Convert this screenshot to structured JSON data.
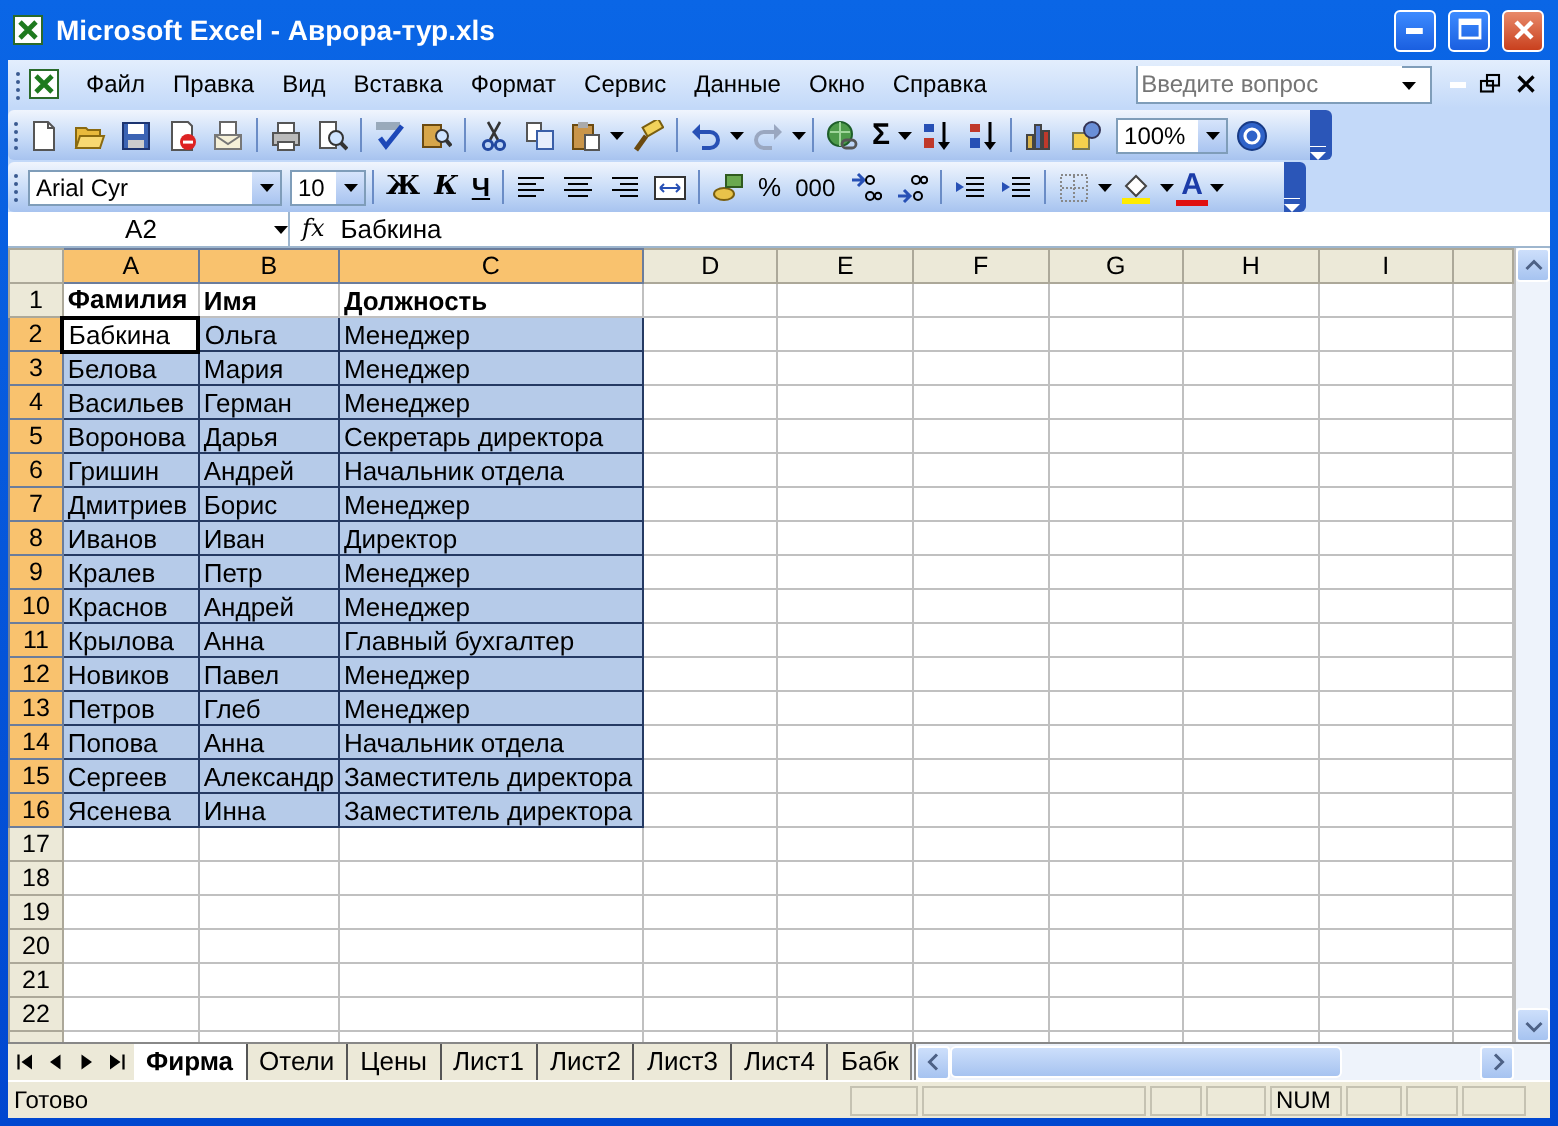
{
  "window": {
    "title": "Microsoft Excel - Аврора-тур.xls"
  },
  "menu": [
    "Файл",
    "Правка",
    "Вид",
    "Вставка",
    "Формат",
    "Сервис",
    "Данные",
    "Окно",
    "Справка"
  ],
  "help_search": {
    "placeholder": "Введите вопрос"
  },
  "standard_toolbar": {
    "autosum": "Σ",
    "zoom": "100%"
  },
  "formatting_toolbar": {
    "font": "Arial Cyr",
    "size": "10",
    "bold": "Ж",
    "italic": "К",
    "underline": "Ч",
    "percent": "%",
    "thousands": "000",
    "font_color": "A"
  },
  "formula_bar": {
    "name_box": "A2",
    "fx": "fx",
    "value": "Бабкина"
  },
  "columns": [
    {
      "label": "A",
      "selected": true
    },
    {
      "label": "B",
      "selected": true
    },
    {
      "label": "C",
      "selected": true
    },
    {
      "label": "D",
      "selected": false
    },
    {
      "label": "E",
      "selected": false
    },
    {
      "label": "F",
      "selected": false
    },
    {
      "label": "G",
      "selected": false
    },
    {
      "label": "H",
      "selected": false
    },
    {
      "label": "I",
      "selected": false
    }
  ],
  "rows": [
    {
      "number": "1",
      "selected": false,
      "bold": true,
      "cells": [
        "Фамилия",
        "Имя",
        "Должность"
      ]
    },
    {
      "number": "2",
      "selected": true,
      "cells": [
        {
          "text": "Бабкина",
          "active": true
        },
        "Ольга",
        "Менеджер"
      ]
    },
    {
      "number": "3",
      "selected": true,
      "cells": [
        "Белова",
        "Мария",
        "Менеджер"
      ]
    },
    {
      "number": "4",
      "selected": true,
      "cells": [
        "Васильев",
        "Герман",
        "Менеджер"
      ]
    },
    {
      "number": "5",
      "selected": true,
      "cells": [
        "Воронова",
        "Дарья",
        "Секретарь директора"
      ]
    },
    {
      "number": "6",
      "selected": true,
      "cells": [
        "Гришин",
        "Андрей",
        "Начальник отдела"
      ]
    },
    {
      "number": "7",
      "selected": true,
      "cells": [
        "Дмитриев",
        "Борис",
        "Менеджер"
      ]
    },
    {
      "number": "8",
      "selected": true,
      "cells": [
        "Иванов",
        "Иван",
        "Директор"
      ]
    },
    {
      "number": "9",
      "selected": true,
      "cells": [
        "Кралев",
        "Петр",
        "Менеджер"
      ]
    },
    {
      "number": "10",
      "selected": true,
      "cells": [
        "Краснов",
        "Андрей",
        "Менеджер"
      ]
    },
    {
      "number": "11",
      "selected": true,
      "cells": [
        "Крылова",
        "Анна",
        "Главный бухгалтер"
      ]
    },
    {
      "number": "12",
      "selected": true,
      "cells": [
        "Новиков",
        "Павел",
        "Менеджер"
      ]
    },
    {
      "number": "13",
      "selected": true,
      "cells": [
        "Петров",
        "Глеб",
        "Менеджер"
      ]
    },
    {
      "number": "14",
      "selected": true,
      "cells": [
        "Попова",
        "Анна",
        "Начальник отдела"
      ]
    },
    {
      "number": "15",
      "selected": true,
      "cells": [
        "Сергеев",
        "Александр",
        "Заместитель директора"
      ]
    },
    {
      "number": "16",
      "selected": true,
      "cells": [
        "Ясенева",
        "Инна",
        "Заместитель директора"
      ]
    },
    {
      "number": "17",
      "selected": false
    },
    {
      "number": "18",
      "selected": false
    },
    {
      "number": "19",
      "selected": false
    },
    {
      "number": "20",
      "selected": false
    },
    {
      "number": "21",
      "selected": false
    },
    {
      "number": "22",
      "selected": false
    }
  ],
  "sheet_tabs": [
    {
      "label": "Фирма",
      "selected": true
    },
    {
      "label": "Отели",
      "selected": false
    },
    {
      "label": "Цены",
      "selected": false
    },
    {
      "label": "Лист1",
      "selected": false
    },
    {
      "label": "Лист2",
      "selected": false
    },
    {
      "label": "Лист3",
      "selected": false
    },
    {
      "label": "Лист4",
      "selected": false
    },
    {
      "label": "Бабк",
      "selected": false
    }
  ],
  "status_bar": {
    "text": "Готово",
    "indicator": "NUM"
  }
}
